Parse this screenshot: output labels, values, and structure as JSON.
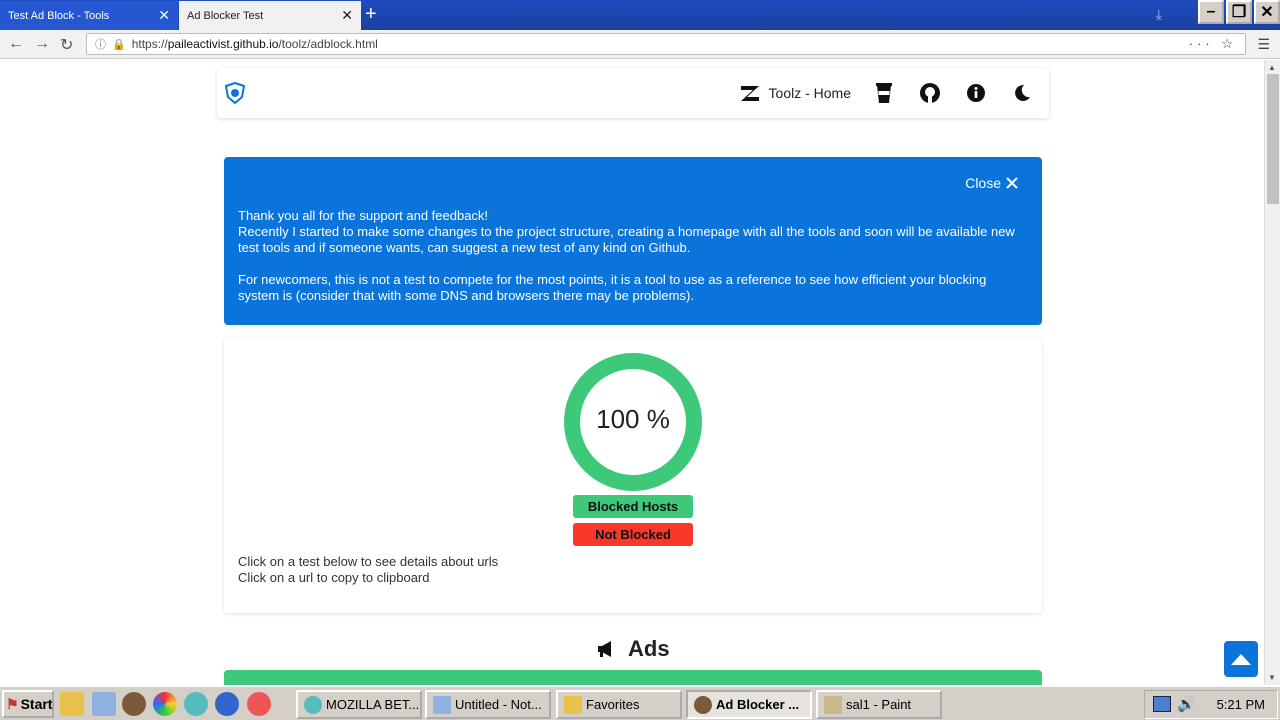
{
  "browser": {
    "tabs": [
      {
        "title": "Test Ad Block - Tools",
        "active": false
      },
      {
        "title": "Ad Blocker Test",
        "active": true
      }
    ],
    "url_scheme": "https://",
    "url_host": "paileactivist.github.io",
    "url_path": "/toolz/adblock.html"
  },
  "site": {
    "nav_home_label": "Toolz - Home",
    "nav_icons": [
      "coffee-icon",
      "github-icon",
      "info-icon",
      "moon-icon"
    ]
  },
  "notice": {
    "close_label": "Close",
    "line1": "Thank you all for the support and feedback!",
    "line2": "Recently I started to make some changes to the project structure, creating a homepage with all the tools and soon will be available new test tools and if someone wants, can suggest a new test of any kind on Github.",
    "line3": "For newcomers, this is not a test to compete for the most points, it is a tool to use as a reference to see how efficient your blocking system is (consider that with some DNS and browsers there may be problems)."
  },
  "result": {
    "score_label": "100 %",
    "score_fraction": 1.0,
    "blocked_label": "Blocked Hosts",
    "not_blocked_label": "Not Blocked",
    "hint1": "Click on a test below to see details about urls",
    "hint2": "Click on a url to copy to clipboard"
  },
  "section": {
    "title": "Ads"
  },
  "colors": {
    "accent": "#0a74da",
    "green": "#3ec97a",
    "red": "#f8382a"
  },
  "taskbar": {
    "start_label": "Start",
    "items": [
      {
        "label": "MOZILLA BET...",
        "active": false
      },
      {
        "label": "Untitled - Not...",
        "active": false
      },
      {
        "label": "Favorites",
        "active": false
      },
      {
        "label": "Ad Blocker ...",
        "active": true
      },
      {
        "label": "sal1 - Paint",
        "active": false
      }
    ],
    "clock": "5:21 PM"
  }
}
